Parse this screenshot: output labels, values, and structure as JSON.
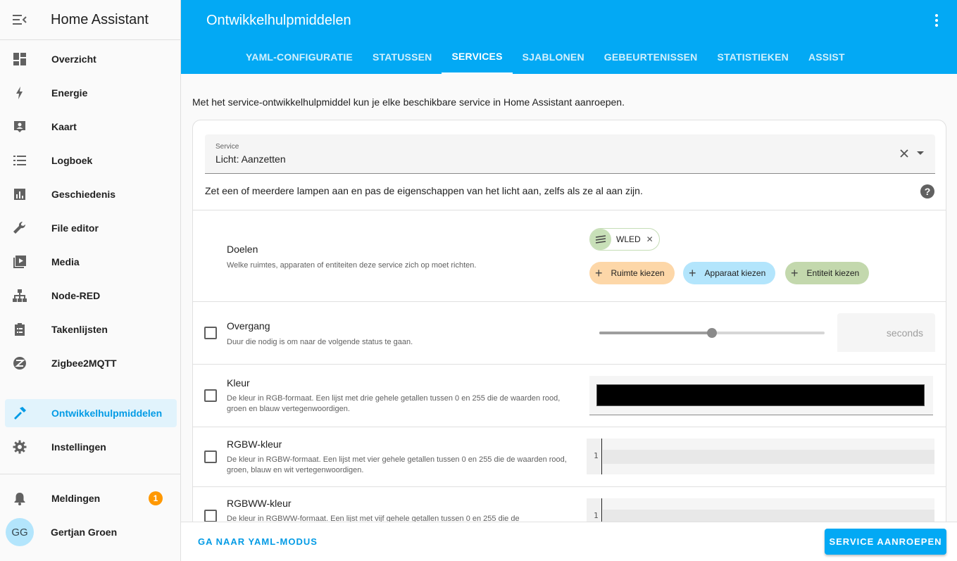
{
  "sidebar": {
    "title": "Home Assistant",
    "items": [
      {
        "label": "Overzicht",
        "icon": "dashboard-icon"
      },
      {
        "label": "Energie",
        "icon": "lightning-icon"
      },
      {
        "label": "Kaart",
        "icon": "map-account-icon"
      },
      {
        "label": "Logboek",
        "icon": "list-icon"
      },
      {
        "label": "Geschiedenis",
        "icon": "chart-icon"
      },
      {
        "label": "File editor",
        "icon": "wrench-icon"
      },
      {
        "label": "Media",
        "icon": "media-icon"
      },
      {
        "label": "Node-RED",
        "icon": "sitemap-icon"
      },
      {
        "label": "Takenlijsten",
        "icon": "clipboard-list-icon"
      },
      {
        "label": "Zigbee2MQTT",
        "icon": "zigbee-icon"
      },
      {
        "label": "Ontwikkelhulpmiddelen",
        "icon": "hammer-icon"
      },
      {
        "label": "Instellingen",
        "icon": "gear-icon"
      }
    ],
    "notifications": {
      "label": "Meldingen",
      "count": "1"
    },
    "user": {
      "initials": "GG",
      "name": "Gertjan Groen"
    }
  },
  "header": {
    "title": "Ontwikkelhulpmiddelen",
    "tabs": [
      "YAML-CONFIGURATIE",
      "STATUSSEN",
      "SERVICES",
      "SJABLONEN",
      "GEBEURTENISSEN",
      "STATISTIEKEN",
      "ASSIST"
    ],
    "active_tab": "SERVICES"
  },
  "intro": "Met het service-ontwikkelhulpmiddel kun je elke beschikbare service in Home Assistant aanroepen.",
  "service": {
    "label": "Service",
    "value": "Licht: Aanzetten",
    "description": "Zet een of meerdere lampen aan en pas de eigenschappen van het licht aan, zelfs als ze al aan zijn."
  },
  "fields": {
    "targets": {
      "title": "Doelen",
      "desc": "Welke ruimtes, apparaten of entiteiten deze service zich op moet richten.",
      "chip": "WLED",
      "pick_area": "Ruimte kiezen",
      "pick_device": "Apparaat kiezen",
      "pick_entity": "Entiteit kiezen"
    },
    "transition": {
      "title": "Overgang",
      "desc": "Duur die nodig is om naar de volgende status te gaan.",
      "unit": "seconds",
      "slider_fraction": 0.5
    },
    "color": {
      "title": "Kleur",
      "desc": "De kleur in RGB-formaat. Een lijst met drie gehele getallen tussen 0 en 255 die de waarden rood, groen en blauw vertegenwoordigen."
    },
    "rgbw": {
      "title": "RGBW-kleur",
      "desc": "De kleur in RGBW-formaat. Een lijst met vier gehele getallen tussen 0 en 255 die de waarden rood, groen, blauw en wit vertegenwoordigen.",
      "line": "1"
    },
    "rgbww": {
      "title": "RGBWW-kleur",
      "desc": "De kleur in RGBWW-formaat. Een lijst met vijf gehele getallen tussen 0 en 255 die de",
      "line": "1"
    }
  },
  "footer": {
    "yaml_mode": "GA NAAR YAML-MODUS",
    "call_service": "SERVICE AANROEPEN"
  },
  "colors": {
    "primary": "#03a9f4",
    "accent": "#ff9800"
  }
}
